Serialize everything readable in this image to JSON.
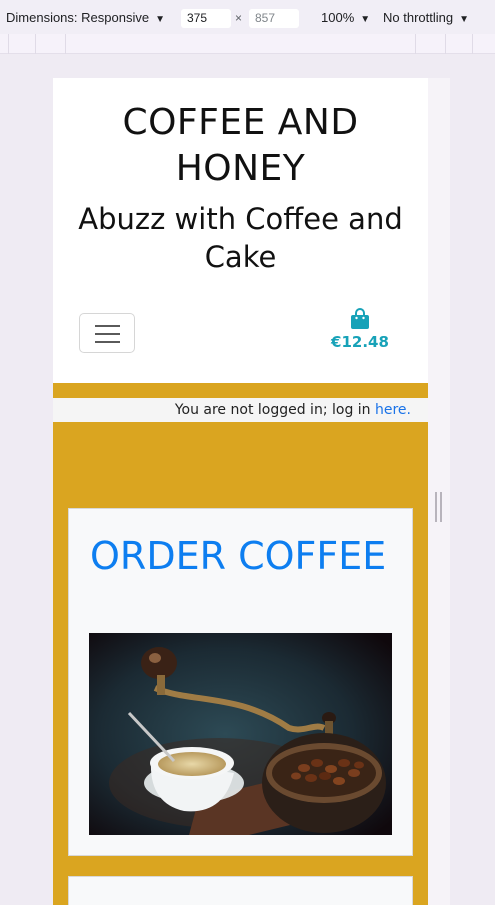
{
  "devtools": {
    "dimensions_label": "Dimensions: Responsive",
    "width": "375",
    "times": "×",
    "height": "857",
    "zoom": "100%",
    "throttle": "No throttling",
    "caret": "▼"
  },
  "site": {
    "title": "COFFEE AND HONEY",
    "tagline": "Abuzz with Coffee and Cake",
    "bag_total": "€12.48"
  },
  "login": {
    "text": "You are not logged in; log in ",
    "link": "here."
  },
  "cards": [
    {
      "title": "ORDER COFFEE"
    }
  ],
  "colors": {
    "accent_gold": "#daa520",
    "link_blue": "#0d7ef0",
    "bag_teal": "#17a2b8"
  },
  "icons": {
    "bag": "shopping-bag-icon",
    "menu": "hamburger-icon"
  }
}
